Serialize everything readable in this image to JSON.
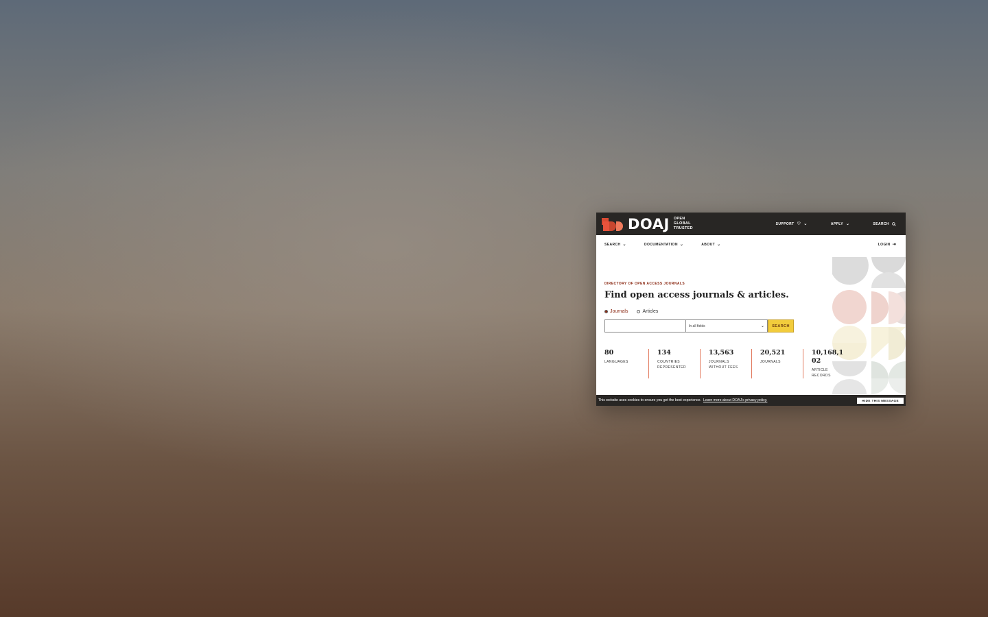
{
  "header": {
    "logo_text": "DOAJ",
    "tagline": [
      "OPEN",
      "GLOBAL",
      "TRUSTED"
    ],
    "actions": [
      {
        "label": "SUPPORT",
        "icon": "heart-icon"
      },
      {
        "label": "APPLY",
        "icon": "chevron-down-icon"
      },
      {
        "label": "SEARCH",
        "icon": "search-icon"
      }
    ]
  },
  "nav": {
    "items": [
      "SEARCH",
      "DOCUMENTATION",
      "ABOUT"
    ],
    "login": "LOGIN"
  },
  "main": {
    "eyebrow": "DIRECTORY OF OPEN ACCESS JOURNALS",
    "title": "Find open access journals & articles.",
    "radio_journals": "Journals",
    "radio_articles": "Articles",
    "selected": "Journals",
    "search_placeholder": "",
    "field_select": "In all fields",
    "search_button": "SEARCH"
  },
  "stats": [
    {
      "value": "80",
      "label": "LANGUAGES"
    },
    {
      "value": "134",
      "label": "COUNTRIES REPRESENTED"
    },
    {
      "value": "13,563",
      "label": "JOURNALS WITHOUT FEES"
    },
    {
      "value": "20,521",
      "label": "JOURNALS"
    },
    {
      "value": "10,168,102",
      "label": "ARTICLE RECORDS"
    }
  ],
  "cookie": {
    "text": "This website uses cookies to ensure you get the best experience.",
    "link": "Learn more about DOAJ's privacy policy.",
    "button": "HIDE THIS MESSAGE"
  },
  "colors": {
    "brand_dark": "#282624",
    "accent_red": "#8b2a14",
    "search_yellow": "#f2cc3c"
  }
}
